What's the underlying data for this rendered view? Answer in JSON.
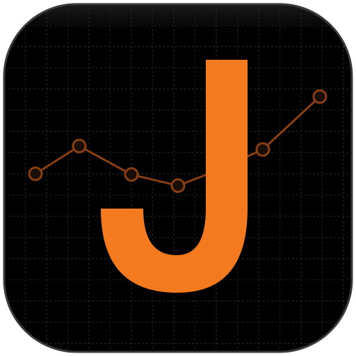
{
  "app_icon": {
    "icon_name": "chart-line-icon",
    "letter": "J",
    "colors": {
      "tile": "#000000",
      "tile_edge": "#3a3a3a",
      "grid_minor": "#1f1f1f",
      "grid_major": "#2c2c2c",
      "line": "#8a3f12",
      "marker_fill": "#1a0d06",
      "letter": "#f47a1f"
    }
  }
}
